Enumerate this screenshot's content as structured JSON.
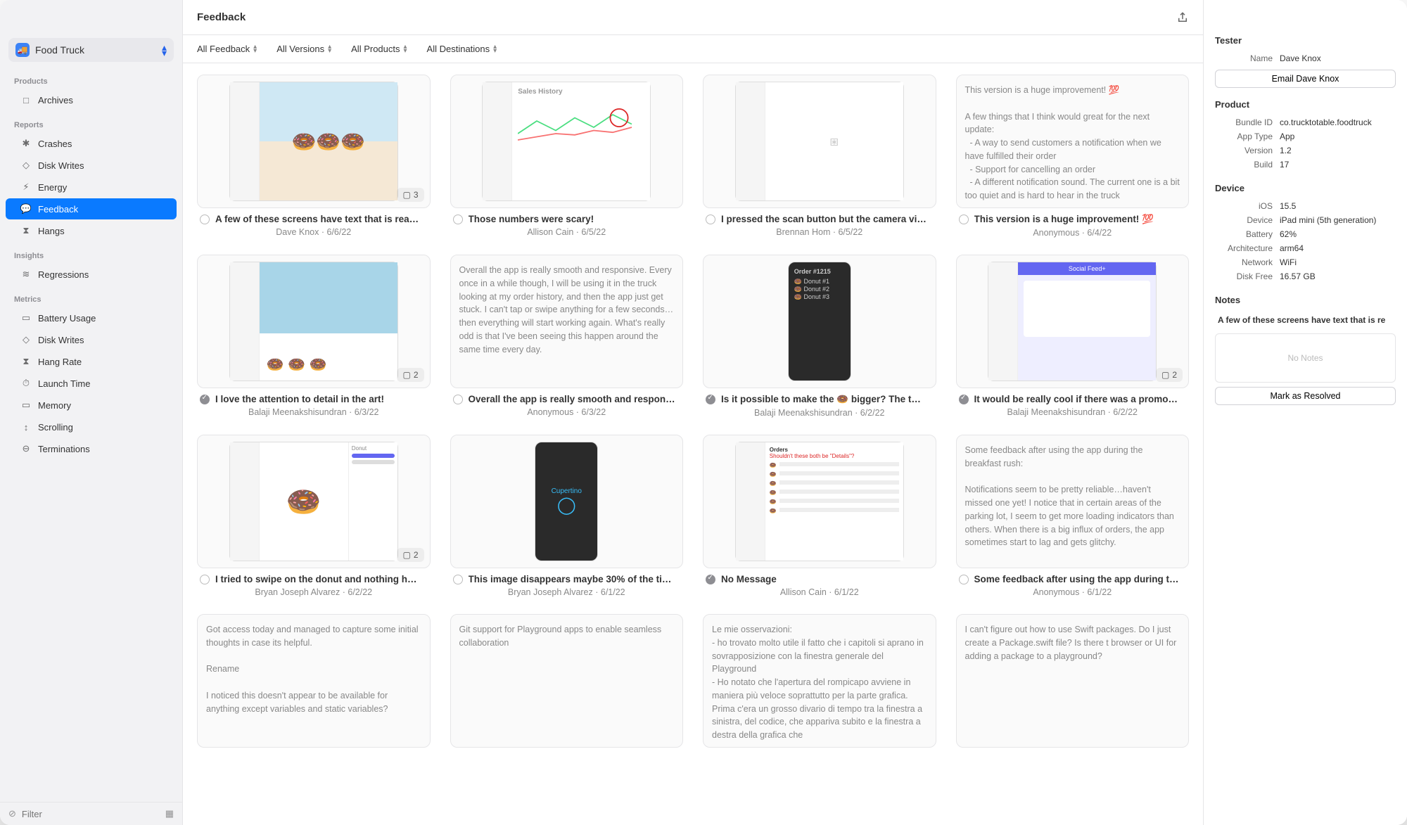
{
  "app_switcher": {
    "name": "Food Truck"
  },
  "sidebar": {
    "sections": [
      {
        "label": "Products",
        "items": [
          {
            "name": "Archives",
            "icon": "archive-icon"
          }
        ]
      },
      {
        "label": "Reports",
        "items": [
          {
            "name": "Crashes",
            "icon": "crash-icon"
          },
          {
            "name": "Disk Writes",
            "icon": "disk-icon"
          },
          {
            "name": "Energy",
            "icon": "energy-icon"
          },
          {
            "name": "Feedback",
            "icon": "feedback-icon",
            "active": true
          },
          {
            "name": "Hangs",
            "icon": "hangs-icon"
          }
        ]
      },
      {
        "label": "Insights",
        "items": [
          {
            "name": "Regressions",
            "icon": "regressions-icon"
          }
        ]
      },
      {
        "label": "Metrics",
        "items": [
          {
            "name": "Battery Usage",
            "icon": "battery-icon"
          },
          {
            "name": "Disk Writes",
            "icon": "disk-icon"
          },
          {
            "name": "Hang Rate",
            "icon": "hourglass-icon"
          },
          {
            "name": "Launch Time",
            "icon": "launch-icon"
          },
          {
            "name": "Memory",
            "icon": "memory-icon"
          },
          {
            "name": "Scrolling",
            "icon": "scroll-icon"
          },
          {
            "name": "Terminations",
            "icon": "terminations-icon"
          }
        ]
      }
    ],
    "filter_placeholder": "Filter"
  },
  "header": {
    "title": "Feedback"
  },
  "filters": [
    {
      "label": "All Feedback"
    },
    {
      "label": "All Versions"
    },
    {
      "label": "All Products"
    },
    {
      "label": "All Destinations"
    }
  ],
  "cards": [
    {
      "title": "A few of these screens have text that is rea…",
      "meta": "Dave Knox  ·  6/6/22",
      "status": "open",
      "badge": "3",
      "thumb": "app-ipad-donuts"
    },
    {
      "title": "Those numbers were scary!",
      "meta": "Allison Cain  ·  6/5/22",
      "status": "open",
      "thumb": "sales-history-markup"
    },
    {
      "title": "I pressed the scan button but the camera vi…",
      "meta": "Brennan Hom  ·  6/5/22",
      "status": "open",
      "thumb": "blank-camera"
    },
    {
      "title": "This version is a huge improvement! 💯",
      "meta": "Anonymous  ·  6/4/22",
      "status": "open",
      "thumb": "text",
      "text": "This version is a huge improvement! 💯\n\nA few things that I think would great for the next update:\n  - A way to send customers a notification when we have fulfilled their order\n  - Support for cancelling an order\n  - A different notification sound. The current one is a bit too quiet and is hard to hear in the truck"
    },
    {
      "title": "I love the attention to detail in the art!",
      "meta": "Balaji Meenakshisundran  ·  6/3/22",
      "status": "resolved",
      "badge": "2",
      "thumb": "donut-scenes"
    },
    {
      "title": "Overall the app is really smooth and respon…",
      "meta": "Anonymous  ·  6/3/22",
      "status": "open",
      "thumb": "text",
      "text": "Overall the app is really smooth and responsive. Every once in a while though, I will be using it in the truck looking at my order history, and then the app just get stuck. I can't tap or swipe anything for a few seconds…then everything will start working again. What's really odd is that I've been seeing this happen around the same time every day."
    },
    {
      "title": "Is it possible to make the 🍩 bigger? The t…",
      "meta": "Balaji Meenakshisundran  ·  6/2/22",
      "status": "resolved",
      "thumb": "dark-order-detail"
    },
    {
      "title": "It would be really cool if there was a promo…",
      "meta": "Balaji Meenakshisundran  ·  6/2/22",
      "status": "resolved",
      "badge": "2",
      "thumb": "social-feed"
    },
    {
      "title": "I tried to swipe on the donut and nothing h…",
      "meta": "Bryan Joseph Alvarez  ·  6/2/22",
      "status": "open",
      "badge": "2",
      "thumb": "donut-editor"
    },
    {
      "title": "This image disappears maybe 30% of the ti…",
      "meta": "Bryan Joseph Alvarez  ·  6/1/22",
      "status": "open",
      "thumb": "dark-city-card"
    },
    {
      "title": "No Message",
      "meta": "Allison Cain  ·  6/1/22",
      "status": "resolved",
      "thumb": "orders-table"
    },
    {
      "title": "Some feedback after using the app during t…",
      "meta": "Anonymous  ·  6/1/22",
      "status": "open",
      "thumb": "text",
      "text": "Some feedback after using the app during the breakfast rush:\n\nNotifications seem to be pretty reliable…haven't missed one yet! I notice that in certain areas of the parking lot, I seem to get more loading indicators than others. When there is a big influx of orders, the app sometimes start to lag and gets glitchy."
    },
    {
      "title_hidden": true,
      "thumb": "text",
      "text": "Got access today and managed to capture some initial thoughts in case its helpful.\n\nRename\n\nI noticed this doesn't appear to be available for anything except variables and static variables?"
    },
    {
      "title_hidden": true,
      "thumb": "text",
      "text": "Git support for Playground apps to enable seamless collaboration"
    },
    {
      "title_hidden": true,
      "thumb": "text",
      "text": "Le mie osservazioni:\n- ho trovato molto utile il fatto che i capitoli si aprano in sovrapposizione con la finestra generale del Playground\n- Ho notato che l'apertura del rompicapo avviene in maniera più veloce soprattutto per la parte grafica. Prima c'era un grosso divario di tempo tra la finestra a sinistra, del codice, che appariva subito e la finestra a destra della grafica che"
    },
    {
      "title_hidden": true,
      "thumb": "text",
      "text": "I can't figure out how to use Swift packages. Do I just create a Package.swift file? Is there t browser or UI for adding a package to a playground?"
    }
  ],
  "inspector": {
    "tester": {
      "heading": "Tester",
      "name_label": "Name",
      "name": "Dave Knox",
      "email_button": "Email Dave Knox"
    },
    "product": {
      "heading": "Product",
      "bundle_id_label": "Bundle ID",
      "bundle_id": "co.trucktotable.foodtruck",
      "app_type_label": "App Type",
      "app_type": "App",
      "version_label": "Version",
      "version": "1.2",
      "build_label": "Build",
      "build": "17"
    },
    "device": {
      "heading": "Device",
      "ios_label": "iOS",
      "ios": "15.5",
      "device_label": "Device",
      "device": "iPad mini (5th generation)",
      "battery_label": "Battery",
      "battery": "62%",
      "arch_label": "Architecture",
      "arch": "arm64",
      "network_label": "Network",
      "network": "WiFi",
      "disk_label": "Disk Free",
      "disk": "16.57 GB"
    },
    "notes": {
      "heading": "Notes",
      "preview": "A few of these screens have text that is re",
      "placeholder": "No Notes",
      "resolve_button": "Mark as Resolved"
    }
  }
}
